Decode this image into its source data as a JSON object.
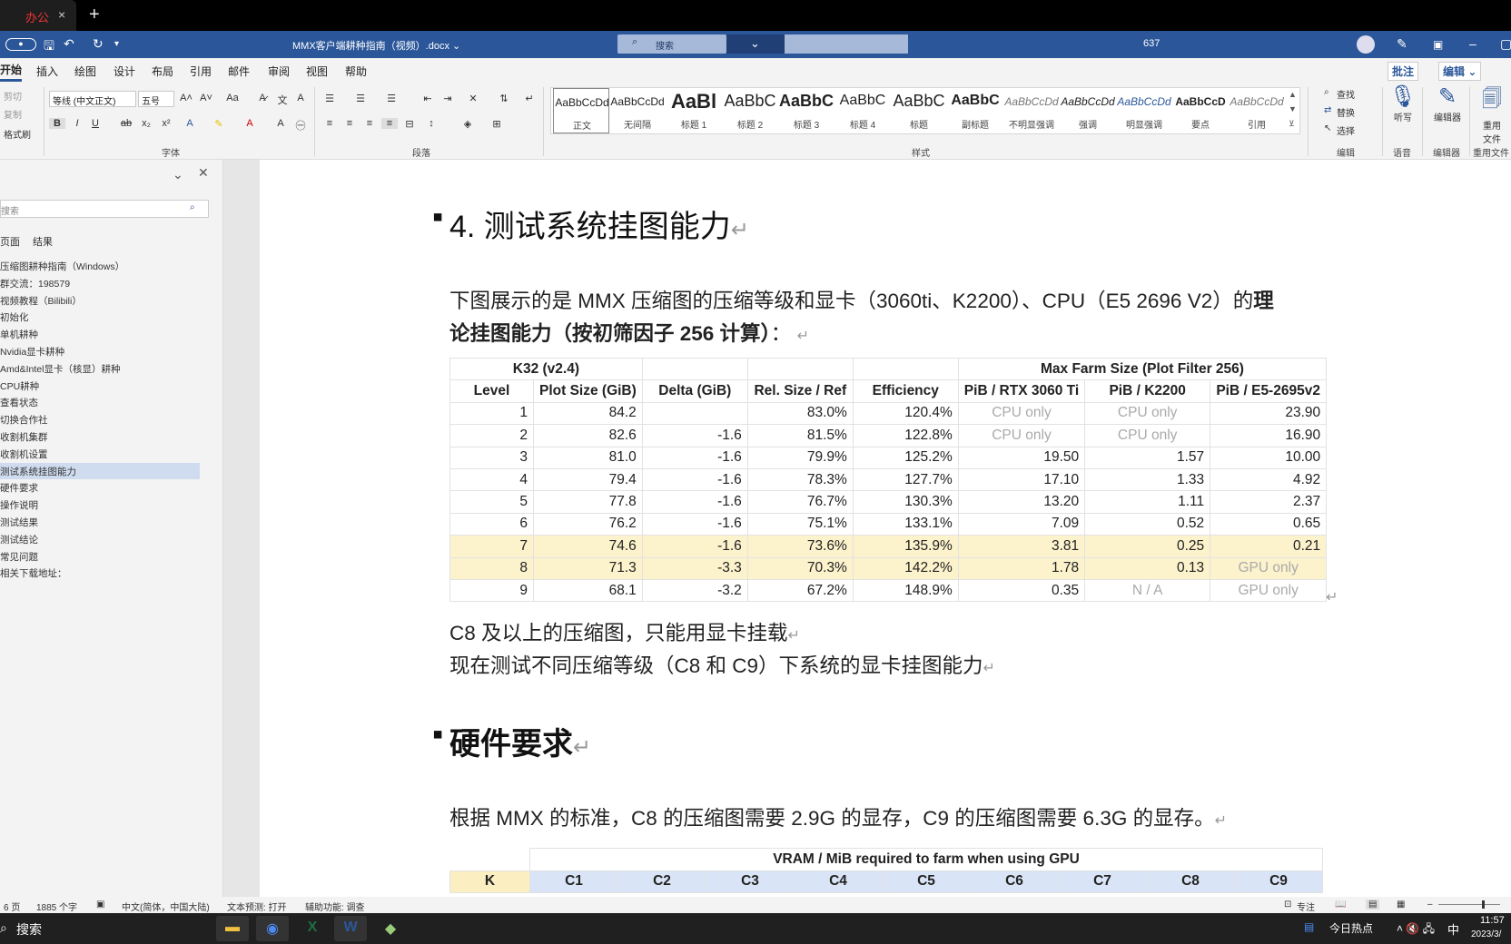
{
  "browser": {
    "tab_label": "办公",
    "new_tab_glyph": "+",
    "close_glyph": "×"
  },
  "titlebar": {
    "doc_title": "MMX客户端耕种指南（视频）.docx ⌄",
    "search_placeholder": "搜索",
    "page_num": "637"
  },
  "menu": [
    "开始",
    "插入",
    "绘图",
    "设计",
    "布局",
    "引用",
    "邮件",
    "审阅",
    "视图",
    "帮助"
  ],
  "menu_right": {
    "comment": "批注",
    "edit": "编辑 ⌄"
  },
  "ribbon": {
    "clipboard": {
      "cut": "剪切",
      "copy": "复制",
      "painter": "格式刷"
    },
    "font": {
      "name": "等线 (中文正文)",
      "size": "五号",
      "group_label": "字体"
    },
    "paragraph_label": "段落",
    "styles_label": "样式",
    "styles": [
      {
        "sample": "AaBbCcDd",
        "name": "正文"
      },
      {
        "sample": "AaBbCcDd",
        "name": "无间隔"
      },
      {
        "sample": "AaBl",
        "name": "标题 1"
      },
      {
        "sample": "AaBbC",
        "name": "标题 2"
      },
      {
        "sample": "AaBbC",
        "name": "标题 3"
      },
      {
        "sample": "AaBbC",
        "name": "标题 4"
      },
      {
        "sample": "AaBbC",
        "name": "标题"
      },
      {
        "sample": "AaBbC",
        "name": "副标题"
      },
      {
        "sample": "AaBbCcDd",
        "name": "不明显强调"
      },
      {
        "sample": "AaBbCcDd",
        "name": "强调"
      },
      {
        "sample": "AaBbCcDd",
        "name": "明显强调"
      },
      {
        "sample": "AaBbCcD",
        "name": "要点"
      },
      {
        "sample": "AaBbCcDd",
        "name": "引用"
      }
    ],
    "editing": {
      "find": "查找",
      "replace": "替换",
      "select": "选择",
      "label": "编辑"
    },
    "voice": {
      "dictate": "听写",
      "label": "语音"
    },
    "editor": {
      "name": "编辑器",
      "label": "编辑器"
    },
    "reuse": {
      "name": "重用文件",
      "label": "重用文件"
    }
  },
  "nav": {
    "search_placeholder": "搜索",
    "tabs": [
      "页面",
      "结果"
    ],
    "items": [
      "压缩图耕种指南（Windows）",
      "群交流：198579",
      "视频教程（Bilibili）",
      "初始化",
      "单机耕种",
      "Nvidia显卡耕种",
      "Amd&Intel显卡（核显）耕种",
      "CPU耕种",
      "查看状态",
      "切换合作社",
      "收割机集群",
      "收割机设置",
      "测试系统挂图能力",
      "硬件要求",
      "操作说明",
      "测试结果",
      "测试结论",
      "常见问题",
      "相关下载地址："
    ],
    "selected_index": 12
  },
  "doc": {
    "heading1": "4.  测试系统挂图能力",
    "intro_line1_a": "下图展示的是 MMX 压缩图的压缩等级和显卡（3060ti、K2200）、CPU（E5 2696 V2）的",
    "intro_line1_b": "理",
    "intro_line2_a": "论挂图能力（按初筛因子 256 计算）",
    "intro_line2_b": "：",
    "table": {
      "title_left": "K32 (v2.4)",
      "title_right": "Max Farm Size (Plot Filter 256)",
      "headers": [
        "Level",
        "Plot Size (GiB)",
        "Delta (GiB)",
        "Rel. Size / Ref",
        "Efficiency",
        "PiB / RTX 3060 Ti",
        "PiB / K2200",
        "PiB / E5-2695v2"
      ],
      "rows": [
        [
          "1",
          "84.2",
          "",
          "83.0%",
          "120.4%",
          "CPU only",
          "CPU only",
          "23.90"
        ],
        [
          "2",
          "82.6",
          "-1.6",
          "81.5%",
          "122.8%",
          "CPU only",
          "CPU only",
          "16.90"
        ],
        [
          "3",
          "81.0",
          "-1.6",
          "79.9%",
          "125.2%",
          "19.50",
          "1.57",
          "10.00"
        ],
        [
          "4",
          "79.4",
          "-1.6",
          "78.3%",
          "127.7%",
          "17.10",
          "1.33",
          "4.92"
        ],
        [
          "5",
          "77.8",
          "-1.6",
          "76.7%",
          "130.3%",
          "13.20",
          "1.11",
          "2.37"
        ],
        [
          "6",
          "76.2",
          "-1.6",
          "75.1%",
          "133.1%",
          "7.09",
          "0.52",
          "0.65"
        ],
        [
          "7",
          "74.6",
          "-1.6",
          "73.6%",
          "135.9%",
          "3.81",
          "0.25",
          "0.21"
        ],
        [
          "8",
          "71.3",
          "-3.3",
          "70.3%",
          "142.2%",
          "1.78",
          "0.13",
          "GPU only"
        ],
        [
          "9",
          "68.1",
          "-3.2",
          "67.2%",
          "148.9%",
          "0.35",
          "N / A",
          "GPU only"
        ]
      ]
    },
    "line_c8": "C8 及以上的压缩图，只能用显卡挂载",
    "line_test": "现在测试不同压缩等级（C8 和 C9）下系统的显卡挂图能力",
    "heading2": "硬件要求",
    "vram_line": "根据 MMX 的标准，C8 的压缩图需要 2.9G 的显存，C9 的压缩图需要 6.3G 的显存。",
    "vram_table": {
      "title": "VRAM / MiB required to farm when using GPU",
      "first": "K",
      "cols": [
        "C1",
        "C2",
        "C3",
        "C4",
        "C5",
        "C6",
        "C7",
        "C8",
        "C9"
      ]
    },
    "para_mark": "↵"
  },
  "status": {
    "page": "6 页",
    "words": "1885 个字",
    "lang": "中文(简体，中国大陆)",
    "predict": "文本预测: 打开",
    "access": "辅助功能: 调查",
    "focus": "专注"
  },
  "taskbar": {
    "search": "搜索",
    "news": "今日热点",
    "ime": "中",
    "time": "11:57",
    "date": "2023/3/"
  },
  "colors": {
    "word_blue": "#2b579a",
    "highlight_row": "#fcf2cc",
    "k_cell": "#fbefc2",
    "c_cell": "#d9e4f6",
    "nav_selected": "#cfdcf0"
  }
}
